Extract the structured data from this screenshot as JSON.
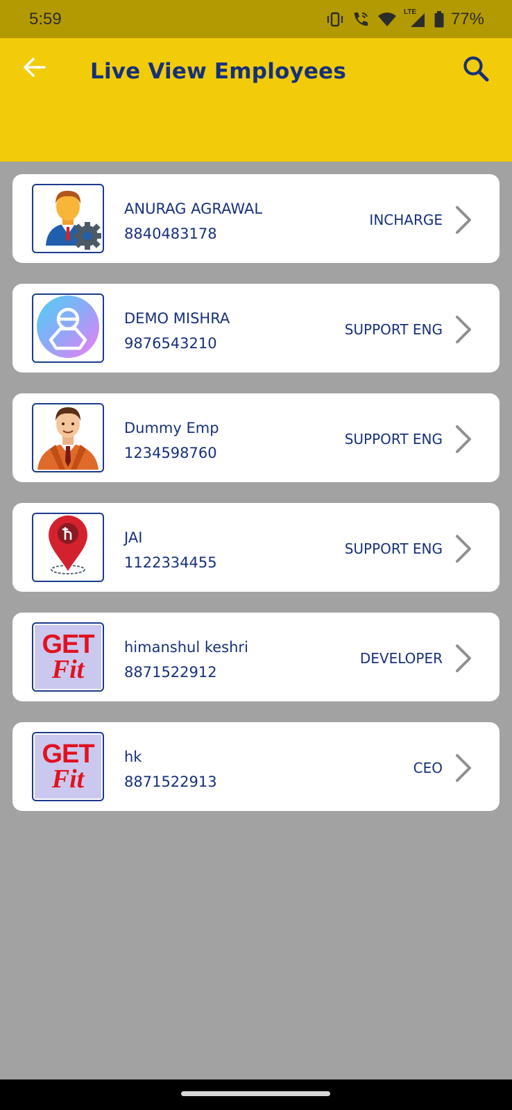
{
  "status_bar": {
    "time": "5:59",
    "battery": "77%",
    "network": "LTE",
    "icons": [
      "vibrate-icon",
      "wifi-calling-icon",
      "wifi-icon",
      "signal-icon",
      "battery-icon"
    ]
  },
  "app_bar": {
    "title": "Live View Employees",
    "back_icon": "arrow-left-icon",
    "search_icon": "search-icon"
  },
  "colors": {
    "app_bar_bg": "#f2cc09",
    "status_bar_bg": "#b49a02",
    "text_primary": "#16307a",
    "page_bg": "#a2a2a2",
    "card_bg": "#ffffff",
    "chevron": "#8f8f8f"
  },
  "employees": [
    {
      "name": "ANURAG AGRAWAL",
      "phone": "8840483178",
      "role": "INCHARGE",
      "avatar": "manager-gear-avatar"
    },
    {
      "name": "DEMO MISHRA",
      "phone": "9876543210",
      "role": "SUPPORT ENG",
      "avatar": "person-gradient-avatar"
    },
    {
      "name": "Dummy Emp",
      "phone": "1234598760",
      "role": "SUPPORT ENG",
      "avatar": "businessman-avatar"
    },
    {
      "name": "JAI",
      "phone": "1122334455",
      "role": "SUPPORT ENG",
      "avatar": "location-pin-avatar"
    },
    {
      "name": "himanshul keshri",
      "phone": "8871522912",
      "role": "DEVELOPER",
      "avatar": "getfit-logo-avatar",
      "avatar_text": [
        "GET",
        "Fit"
      ]
    },
    {
      "name": "hk",
      "phone": "8871522913",
      "role": "CEO",
      "avatar": "getfit-logo-avatar",
      "avatar_text": [
        "GET",
        "Fit"
      ]
    }
  ]
}
